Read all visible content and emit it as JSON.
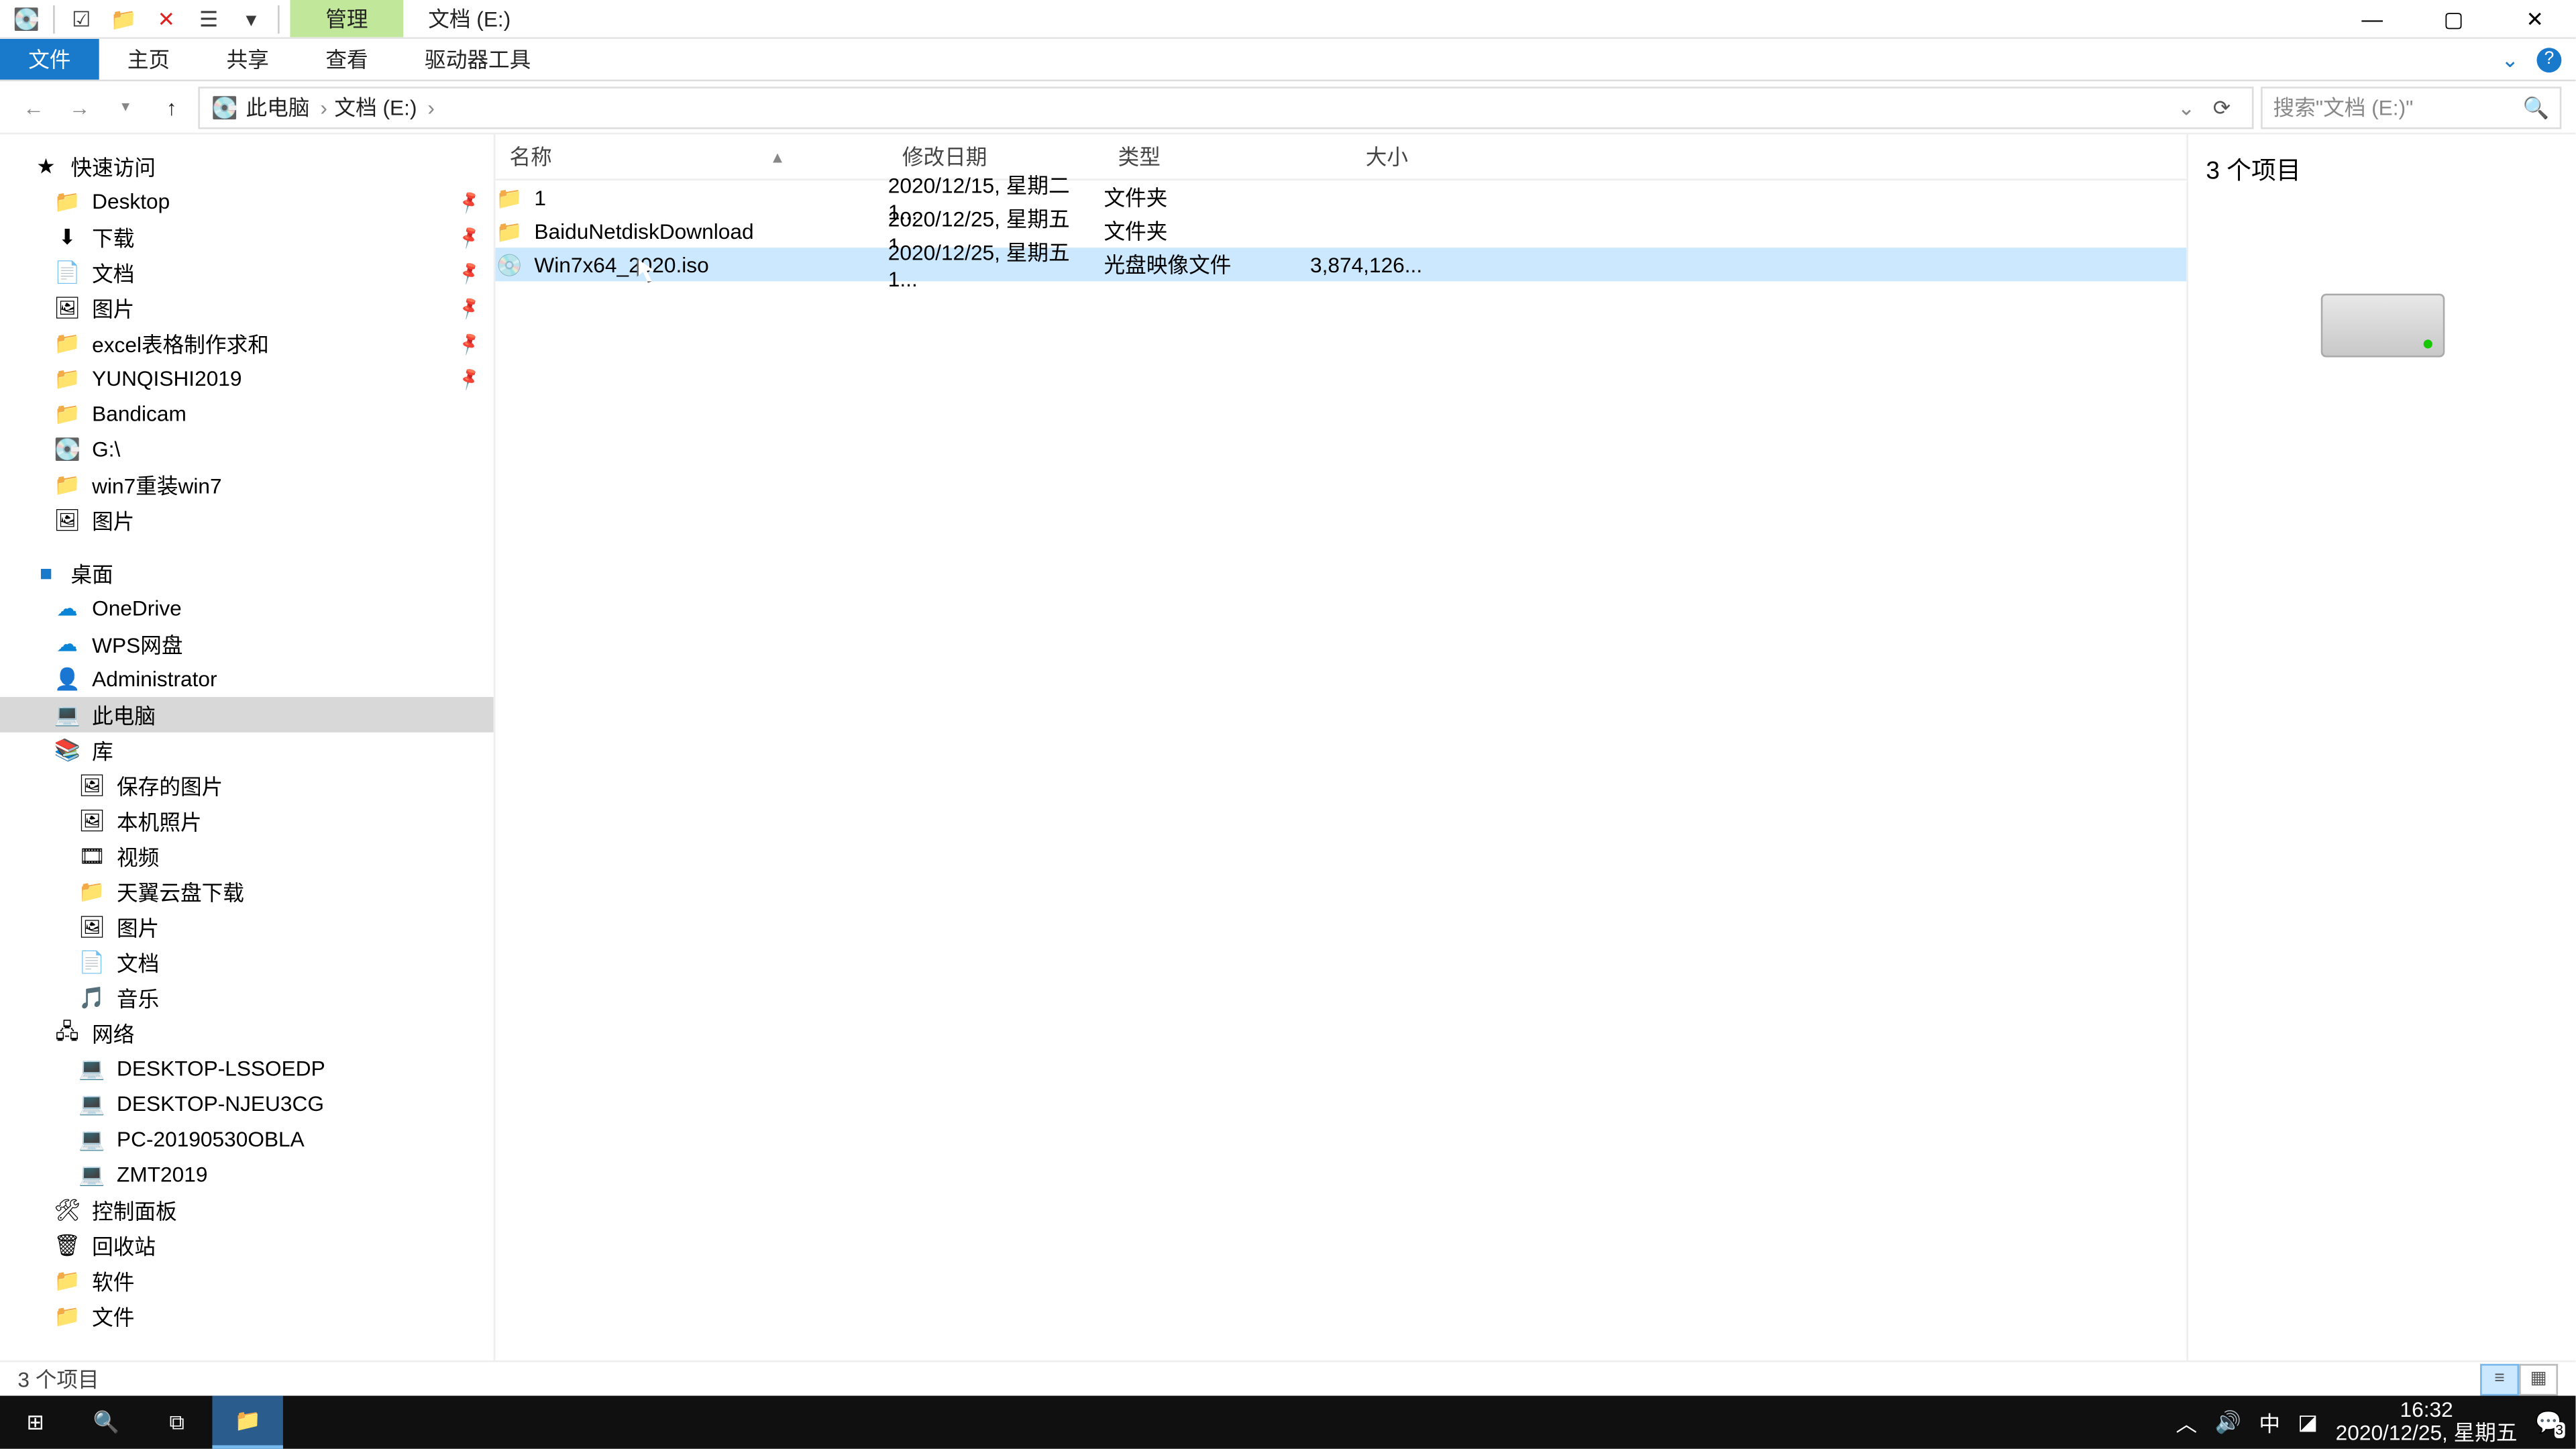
{
  "title": {
    "ribbon_context": "管理",
    "path_tab": "文档 (E:)"
  },
  "ribbon": {
    "file": "文件",
    "home": "主页",
    "share": "共享",
    "view": "查看",
    "drive_tools": "驱动器工具"
  },
  "breadcrumb": {
    "seg1": "此电脑",
    "seg2": "文档 (E:)"
  },
  "search": {
    "placeholder": "搜索\"文档 (E:)\""
  },
  "columns": {
    "name": "名称",
    "date": "修改日期",
    "type": "类型",
    "size": "大小"
  },
  "rows": [
    {
      "name": "1",
      "date": "2020/12/15, 星期二 1...",
      "type": "文件夹",
      "size": ""
    },
    {
      "name": "BaiduNetdiskDownload",
      "date": "2020/12/25, 星期五 1...",
      "type": "文件夹",
      "size": ""
    },
    {
      "name": "Win7x64_2020.iso",
      "date": "2020/12/25, 星期五 1...",
      "type": "光盘映像文件",
      "size": "3,874,126..."
    }
  ],
  "tree": {
    "quick": "快速访问",
    "desktop": "Desktop",
    "downloads": "下载",
    "docs": "文档",
    "pics": "图片",
    "excel": "excel表格制作求和",
    "yunqishi": "YUNQISHI2019",
    "bandicam": "Bandicam",
    "g": "G:\\",
    "win7": "win7重装win7",
    "pics2": "图片",
    "desk": "桌面",
    "onedrive": "OneDrive",
    "wps": "WPS网盘",
    "admin": "Administrator",
    "thispc": "此电脑",
    "lib": "库",
    "saved": "保存的图片",
    "local": "本机照片",
    "video": "视频",
    "tianyi": "天翼云盘下载",
    "pics3": "图片",
    "docs2": "文档",
    "music": "音乐",
    "net": "网络",
    "pc1": "DESKTOP-LSSOEDP",
    "pc2": "DESKTOP-NJEU3CG",
    "pc3": "PC-20190530OBLA",
    "pc4": "ZMT2019",
    "cpl": "控制面板",
    "recycle": "回收站",
    "soft": "软件",
    "file": "文件"
  },
  "preview": {
    "summary": "3 个项目"
  },
  "status": {
    "count": "3 个项目"
  },
  "taskbar": {
    "time": "16:32",
    "date": "2020/12/25, 星期五",
    "ime": "中",
    "count_badge": "3"
  }
}
